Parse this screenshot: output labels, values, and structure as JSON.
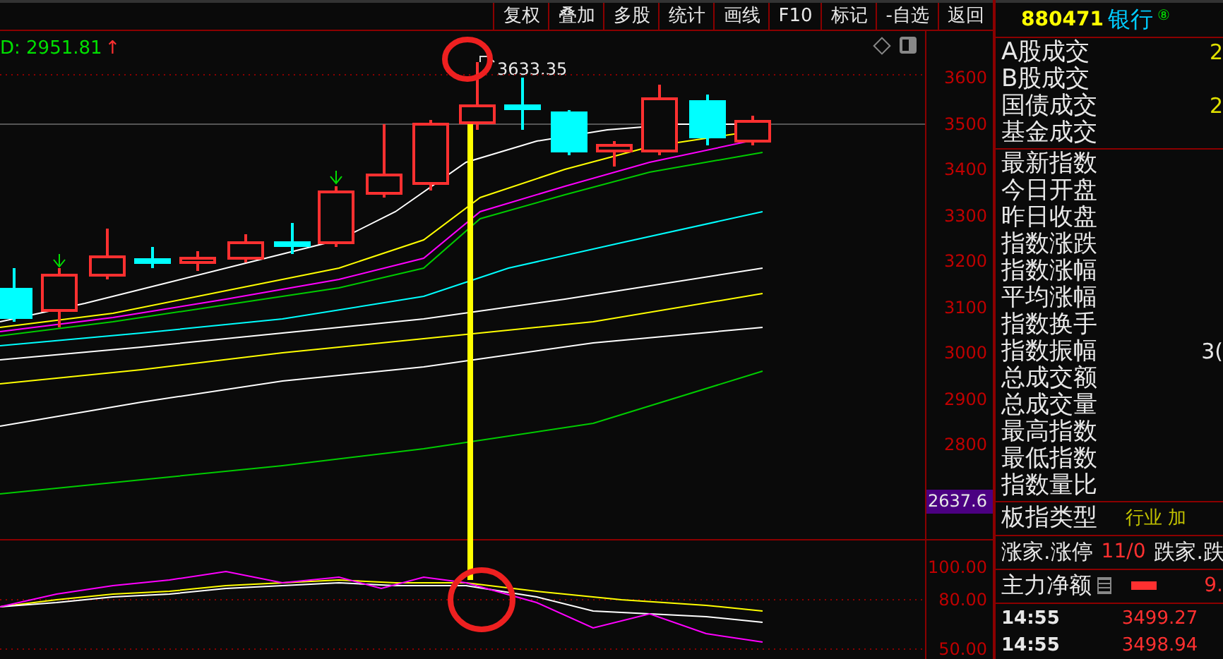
{
  "toolbar": {
    "buttons": [
      "复权",
      "叠加",
      "多股",
      "统计",
      "画线",
      "F10",
      "标记",
      "-自选",
      "返回"
    ]
  },
  "main_chart": {
    "indicator_value": "D: 2951.81",
    "indicator_arrow": "↑",
    "peak_label": "3633.35",
    "y_labels": [
      "3600",
      "3500",
      "3400",
      "3300",
      "3200",
      "3100",
      "3000",
      "2900",
      "2800"
    ],
    "cursor_value": "2637.6"
  },
  "sub_chart": {
    "y_labels": [
      "100.00",
      "80.00",
      "50.00"
    ]
  },
  "side_panel": {
    "code": "880471",
    "name": "银行",
    "badge": "⑧",
    "volume_rows": [
      {
        "label": "A股成交",
        "value": "2"
      },
      {
        "label": "B股成交"
      },
      {
        "label": "国债成交",
        "value": "2"
      },
      {
        "label": "基金成交"
      }
    ],
    "index_rows": [
      {
        "label": "最新指数"
      },
      {
        "label": "今日开盘"
      },
      {
        "label": "昨日收盘"
      },
      {
        "label": "指数涨跌"
      },
      {
        "label": "指数涨幅"
      },
      {
        "label": "平均涨幅"
      },
      {
        "label": "指数换手"
      },
      {
        "label": "指数振幅",
        "value": "3("
      },
      {
        "label": "总成交额"
      },
      {
        "label": "总成交量"
      },
      {
        "label": "最高指数"
      },
      {
        "label": "最低指数"
      },
      {
        "label": "指数量比"
      }
    ],
    "type_row": {
      "label": "板指类型",
      "value": "行业 加"
    },
    "advance_row": {
      "label": "涨家.涨停",
      "value": "11/0",
      "label_2": "跌家.跌"
    },
    "net_row": {
      "label": "主力净额",
      "value": "9."
    },
    "ticks": [
      {
        "time": "14:55",
        "price": "3499.27"
      },
      {
        "time": "14:55",
        "price": "3498.94"
      }
    ]
  }
}
